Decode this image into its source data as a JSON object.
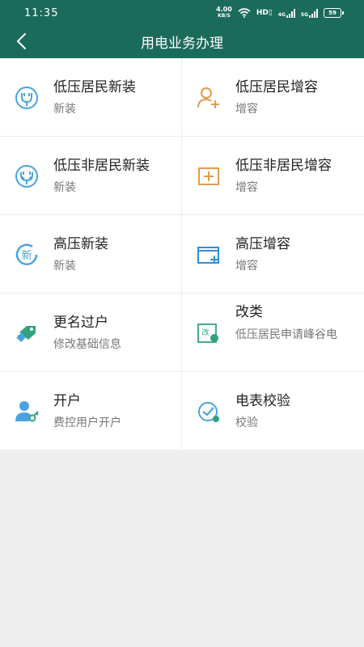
{
  "status_bar": {
    "time": "11:35",
    "speed_value": "4.00",
    "speed_unit": "KB/S",
    "hd": "HD",
    "net1": "4G",
    "net2": "5G",
    "battery": "59"
  },
  "header": {
    "title": "用电业务办理",
    "back_icon": "back-arrow-icon"
  },
  "colors": {
    "primary": "#1b6b5b",
    "icon_blue": "#4aa3df",
    "icon_orange": "#e59a4b",
    "icon_green": "#2fa37f"
  },
  "services": [
    {
      "title": "低压居民新装",
      "subtitle": "新装",
      "icon": "plug-icon"
    },
    {
      "title": "低压居民增容",
      "subtitle": "增容",
      "icon": "user-add-icon"
    },
    {
      "title": "低压非居民新装",
      "subtitle": "新装",
      "icon": "plug-icon"
    },
    {
      "title": "低压非居民增容",
      "subtitle": "增容",
      "icon": "plus-box-icon"
    },
    {
      "title": "高压新装",
      "subtitle": "新装",
      "icon": "new-badge-icon"
    },
    {
      "title": "高压增容",
      "subtitle": "增容",
      "icon": "folder-add-icon"
    },
    {
      "title": "更名过户",
      "subtitle": "修改基础信息",
      "icon": "tag-transfer-icon"
    },
    {
      "title": "改类",
      "subtitle": "低压居民申请峰谷电",
      "icon": "change-doc-icon",
      "icon_text": "改"
    },
    {
      "title": "开户",
      "subtitle": "费控用户开户",
      "icon": "user-key-icon"
    },
    {
      "title": "电表校验",
      "subtitle": "校验",
      "icon": "meter-check-icon"
    }
  ]
}
